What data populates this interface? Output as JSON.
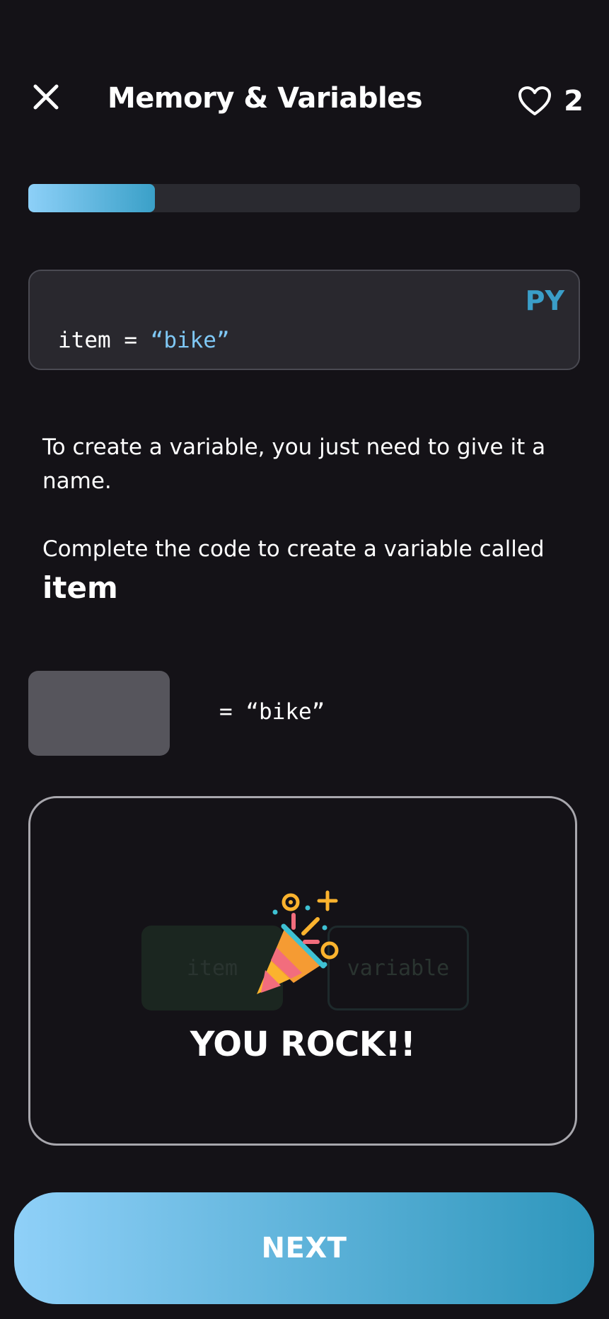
{
  "header": {
    "title": "Memory & Variables",
    "hearts_count": "2"
  },
  "progress": {
    "value_percent": 23
  },
  "code_card": {
    "language": "PY",
    "code_prefix": "item = ",
    "code_string": "“bike”"
  },
  "instructions": {
    "line1": "To create a variable, you just need to give it a name.",
    "line2": "Complete the code to create a variable called",
    "keyword": "item"
  },
  "exercise": {
    "code_tail": "= “bike”"
  },
  "options": [
    {
      "label": "item"
    },
    {
      "label": "variable"
    }
  ],
  "feedback": {
    "message": "YOU ROCK!!"
  },
  "footer": {
    "next_label": "NEXT"
  },
  "colors": {
    "background": "#141217",
    "accent_start": "#8fd0f8",
    "accent_end": "#2e96bc",
    "code_string": "#7fc8f5"
  }
}
